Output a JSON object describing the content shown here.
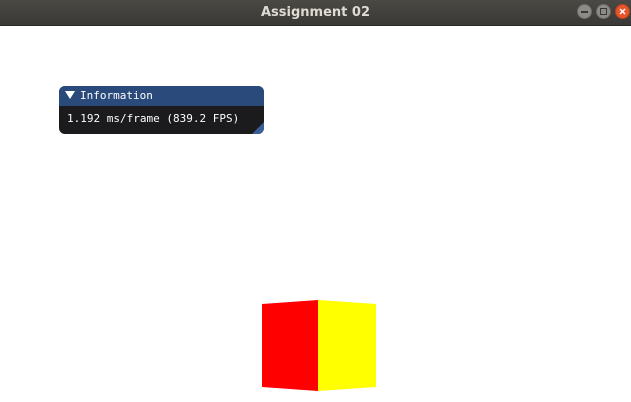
{
  "window": {
    "title": "Assignment 02",
    "buttons": [
      "minimize-icon",
      "maximize-icon",
      "close-icon"
    ]
  },
  "imgui": {
    "panel_title": "Information",
    "fps_text": "1.192 ms/frame (839.2 FPS)",
    "collapse_icon": "triangle-down-icon"
  },
  "scene": {
    "cube_colors": {
      "left_face": "#ff0000",
      "right_face": "#ffff00"
    },
    "background": "#ffffff"
  }
}
